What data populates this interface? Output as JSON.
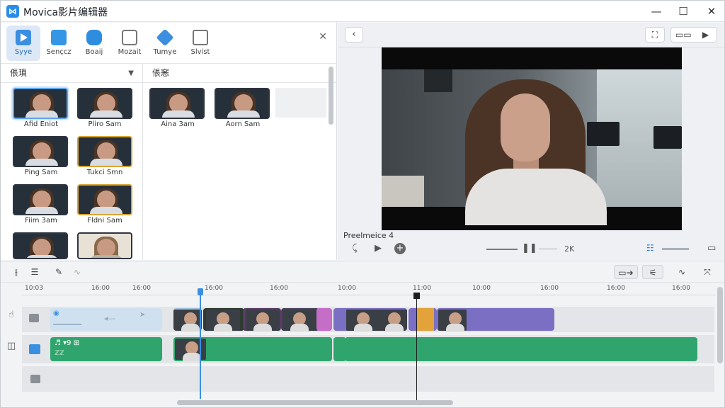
{
  "app": {
    "title": "Movica影片编辑器",
    "icon": "app-logo-icon"
  },
  "window_controls": {
    "minimize": "—",
    "maximize": "☐",
    "close": "✕"
  },
  "toolbar": {
    "items": [
      {
        "label": "Syye",
        "icon": "play-media-icon",
        "active": true
      },
      {
        "label": "Sençcz",
        "icon": "text-icon",
        "active": false
      },
      {
        "label": "Boaij",
        "icon": "audio-icon",
        "active": false
      },
      {
        "label": "Mozait",
        "icon": "transition-icon",
        "active": false
      },
      {
        "label": "Tumye",
        "icon": "effects-icon",
        "active": false
      },
      {
        "label": "Slvist",
        "icon": "record-icon",
        "active": false
      }
    ],
    "close": "✕"
  },
  "media_panel": {
    "header": "倀瑣",
    "thumbs": [
      {
        "label": "Afid Eniot"
      },
      {
        "label": "Pliro Sam"
      },
      {
        "label": "Ping Sam"
      },
      {
        "label": "Tukci Smn"
      },
      {
        "label": "Fiim 3am"
      },
      {
        "label": "Fldni Sam"
      },
      {
        "label": ""
      },
      {
        "label": ""
      }
    ]
  },
  "library_panel": {
    "header": "倀窸",
    "thumbs": [
      {
        "label": "Aina 3am"
      },
      {
        "label": "Aorn Sam"
      }
    ]
  },
  "preview": {
    "back": "‹",
    "status_text": "Preelmeice 4",
    "speed_label": "2K",
    "controls": {
      "prev": "⤹",
      "play": "▶",
      "add": "+",
      "pause": "❚❚"
    }
  },
  "timeline": {
    "ruler_ticks": [
      "10:03",
      "16:00",
      "16:00",
      "16:00",
      "16:00",
      "10:00",
      "11:00",
      "10:00",
      "16:00",
      "16:00",
      "16:00"
    ],
    "video_track": {
      "title": "◉",
      "arrow": "◂—",
      "arrow2": "➤"
    },
    "audio_track": {
      "title": "♬ ▾9 ⊞",
      "sub": "ℤℤ"
    }
  },
  "colors": {
    "accent": "#3b8fe0",
    "audio_green": "#2fa56d",
    "clip_purple": "#7b6fc4",
    "clip_orange": "#e3a23a",
    "clip_pink": "#c46ec8"
  }
}
